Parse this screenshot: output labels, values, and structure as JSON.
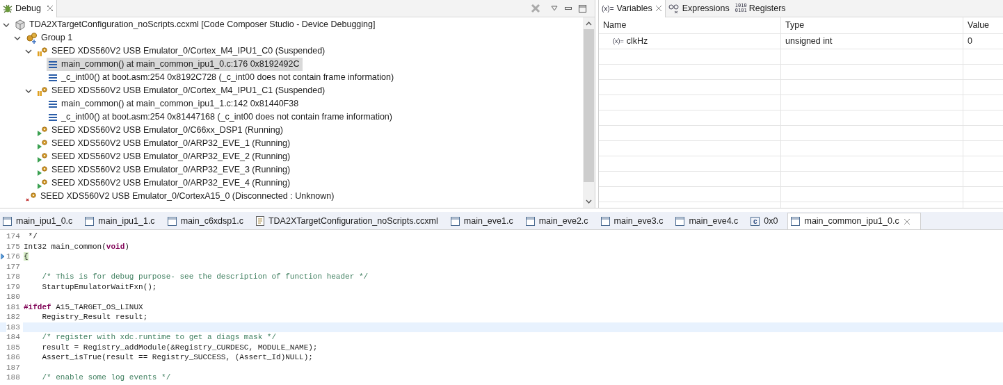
{
  "debug_view": {
    "title": "Debug",
    "tree": [
      {
        "kind": "launch",
        "label": "TDA2XTargetConfiguration_noScripts.ccxml [Code Composer Studio - Device Debugging]",
        "expanded": true,
        "selected": false,
        "children": [
          {
            "kind": "group",
            "label": "Group 1",
            "expanded": true,
            "selected": false,
            "children": [
              {
                "kind": "core-suspended",
                "label": "SEED XDS560V2 USB Emulator_0/Cortex_M4_IPU1_C0 (Suspended)",
                "expanded": true,
                "selected": false,
                "children": [
                  {
                    "kind": "frame",
                    "label": "main_common() at main_common_ipu1_0.c:176 0x8192492C",
                    "selected": true
                  },
                  {
                    "kind": "frame",
                    "label": "_c_int00() at boot.asm:254 0x8192C728  (_c_int00 does not contain frame information)",
                    "selected": false
                  }
                ]
              },
              {
                "kind": "core-suspended",
                "label": "SEED XDS560V2 USB Emulator_0/Cortex_M4_IPU1_C1 (Suspended)",
                "expanded": true,
                "selected": false,
                "children": [
                  {
                    "kind": "frame",
                    "label": "main_common() at main_common_ipu1_1.c:142 0x81440F38",
                    "selected": false
                  },
                  {
                    "kind": "frame",
                    "label": "_c_int00() at boot.asm:254 0x81447168  (_c_int00 does not contain frame information)",
                    "selected": false
                  }
                ]
              },
              {
                "kind": "core-running",
                "label": "SEED XDS560V2 USB Emulator_0/C66xx_DSP1 (Running)",
                "selected": false
              },
              {
                "kind": "core-running",
                "label": "SEED XDS560V2 USB Emulator_0/ARP32_EVE_1 (Running)",
                "selected": false
              },
              {
                "kind": "core-running",
                "label": "SEED XDS560V2 USB Emulator_0/ARP32_EVE_2 (Running)",
                "selected": false
              },
              {
                "kind": "core-running",
                "label": "SEED XDS560V2 USB Emulator_0/ARP32_EVE_3 (Running)",
                "selected": false
              },
              {
                "kind": "core-running",
                "label": "SEED XDS560V2 USB Emulator_0/ARP32_EVE_4 (Running)",
                "selected": false
              }
            ]
          },
          {
            "kind": "core-disconnected",
            "label": "SEED XDS560V2 USB Emulator_0/CortexA15_0 (Disconnected : Unknown)",
            "selected": false
          }
        ]
      }
    ]
  },
  "variables_view": {
    "tabs": [
      {
        "kind": "variables",
        "icon_text": "(x)=",
        "label": "Variables",
        "selected": true
      },
      {
        "kind": "expressions",
        "label": "Expressions",
        "selected": false
      },
      {
        "kind": "registers",
        "icon_text": "1010 0101",
        "label": "Registers",
        "selected": false
      }
    ],
    "columns": [
      "Name",
      "Type",
      "Value"
    ],
    "rows": [
      {
        "icon_text": "(x)=",
        "name": "clkHz",
        "type": "unsigned int",
        "value": "0"
      }
    ]
  },
  "editor": {
    "tabs": [
      {
        "kind": "c-file",
        "label": "main_ipu1_0.c",
        "selected": false
      },
      {
        "kind": "c-file",
        "label": "main_ipu1_1.c",
        "selected": false
      },
      {
        "kind": "c-file",
        "label": "main_c6xdsp1.c",
        "selected": false
      },
      {
        "kind": "config",
        "label": "TDA2XTargetConfiguration_noScripts.ccxml",
        "selected": false
      },
      {
        "kind": "c-file",
        "label": "main_eve1.c",
        "selected": false
      },
      {
        "kind": "c-file",
        "label": "main_eve2.c",
        "selected": false
      },
      {
        "kind": "c-file",
        "label": "main_eve3.c",
        "selected": false
      },
      {
        "kind": "c-file",
        "label": "main_eve4.c",
        "selected": false
      },
      {
        "kind": "disassembly",
        "icon_text": "c",
        "label": "0x0",
        "selected": false
      },
      {
        "kind": "c-file",
        "label": "main_common_ipu1_0.c",
        "selected": true
      }
    ],
    "lines": [
      {
        "number": "174",
        "segments": [
          {
            "kind": "plain",
            "text": " */"
          }
        ]
      },
      {
        "number": "175",
        "segments": [
          {
            "kind": "plain",
            "text": "Int32 main_common("
          },
          {
            "kind": "keyword",
            "text": "void"
          },
          {
            "kind": "plain",
            "text": ")"
          }
        ]
      },
      {
        "number": "176",
        "current": true,
        "segments": [
          {
            "kind": "bracket",
            "text": "{"
          }
        ]
      },
      {
        "number": "177"
      },
      {
        "number": "178",
        "segments": [
          {
            "kind": "comment",
            "text": "    /* This is for debug purpose- see the description of function header */"
          }
        ]
      },
      {
        "number": "179",
        "segments": [
          {
            "kind": "plain",
            "text": "    StartupEmulatorWaitFxn();"
          }
        ]
      },
      {
        "number": "180"
      },
      {
        "number": "181",
        "segments": [
          {
            "kind": "keyword",
            "text": "#ifdef"
          },
          {
            "kind": "plain",
            "text": " A15_TARGET_OS_LINUX"
          }
        ]
      },
      {
        "number": "182",
        "segments": [
          {
            "kind": "plain",
            "text": "    Registry_Result result;"
          }
        ]
      },
      {
        "number": "183",
        "highlighted": true
      },
      {
        "number": "184",
        "segments": [
          {
            "kind": "comment",
            "text": "    /* register with xdc.runtime to get a diags mask */"
          }
        ]
      },
      {
        "number": "185",
        "segments": [
          {
            "kind": "plain",
            "text": "    result = Registry_addModule(&Registry_CURDESC, MODULE_NAME);"
          }
        ]
      },
      {
        "number": "186",
        "segments": [
          {
            "kind": "plain",
            "text": "    Assert_isTrue(result == Registry_SUCCESS, (Assert_Id)NULL);"
          }
        ]
      },
      {
        "number": "187"
      },
      {
        "number": "188",
        "segments": [
          {
            "kind": "comment",
            "text": "    /* enable some log events */"
          }
        ]
      }
    ]
  }
}
